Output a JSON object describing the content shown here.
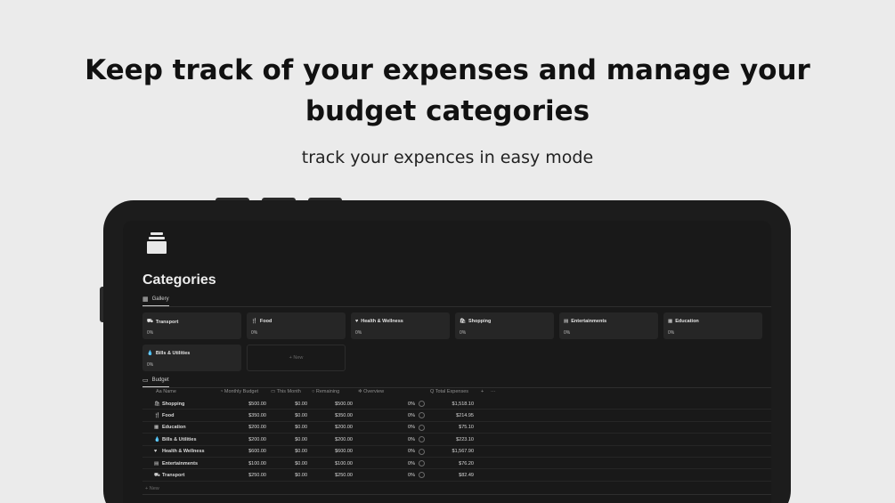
{
  "hero": {
    "headline_line1": "Keep track of your expenses and manage your",
    "headline_line2": "budget categories",
    "subline": "track your expences in easy mode"
  },
  "page": {
    "title": "Categories",
    "gallery_tab": "Gallery",
    "budget_tab": "Budget"
  },
  "gallery": {
    "cards": [
      {
        "icon": "⛟",
        "name": "Transport",
        "percent": "0%"
      },
      {
        "icon": "🍴",
        "name": "Food",
        "percent": "0%"
      },
      {
        "icon": "♥",
        "name": "Health & Wellness",
        "percent": "0%"
      },
      {
        "icon": "🛍",
        "name": "Shopping",
        "percent": "0%"
      },
      {
        "icon": "▤",
        "name": "Entertainments",
        "percent": "0%"
      },
      {
        "icon": "▦",
        "name": "Education",
        "percent": "0%"
      },
      {
        "icon": "💧",
        "name": "Bills & Utilities",
        "percent": "0%"
      }
    ],
    "new_label": "+ New"
  },
  "table": {
    "headers": {
      "name": "Aa Name",
      "monthly_budget": "Monthly Budget",
      "this_month": "This Month",
      "remaining": "Remaining",
      "overview": "Overview",
      "total_expenses": "Total Expenses",
      "add": "+",
      "more": "···"
    },
    "rows": [
      {
        "icon": "🛍",
        "name": "Shopping",
        "monthly_budget": "$500.00",
        "this_month": "$0.00",
        "remaining": "$500.00",
        "percent": "0%",
        "total": "$1,518.10"
      },
      {
        "icon": "🍴",
        "name": "Food",
        "monthly_budget": "$350.00",
        "this_month": "$0.00",
        "remaining": "$350.00",
        "percent": "0%",
        "total": "$214.95"
      },
      {
        "icon": "▦",
        "name": "Education",
        "monthly_budget": "$200.00",
        "this_month": "$0.00",
        "remaining": "$200.00",
        "percent": "0%",
        "total": "$75.10"
      },
      {
        "icon": "💧",
        "name": "Bills & Utilities",
        "monthly_budget": "$200.00",
        "this_month": "$0.00",
        "remaining": "$200.00",
        "percent": "0%",
        "total": "$223.10"
      },
      {
        "icon": "♥",
        "name": "Health & Wellness",
        "monthly_budget": "$600.00",
        "this_month": "$0.00",
        "remaining": "$600.00",
        "percent": "0%",
        "total": "$1,567.90"
      },
      {
        "icon": "▤",
        "name": "Entertainments",
        "monthly_budget": "$100.00",
        "this_month": "$0.00",
        "remaining": "$100.00",
        "percent": "0%",
        "total": "$76.20"
      },
      {
        "icon": "⛟",
        "name": "Transport",
        "monthly_budget": "$250.00",
        "this_month": "$0.00",
        "remaining": "$250.00",
        "percent": "0%",
        "total": "$82.49"
      }
    ],
    "new_label": "+ New"
  },
  "colors": {
    "background": "#ebebeb",
    "device": "#1c1c1c",
    "screen": "#191919",
    "card": "#262626"
  }
}
